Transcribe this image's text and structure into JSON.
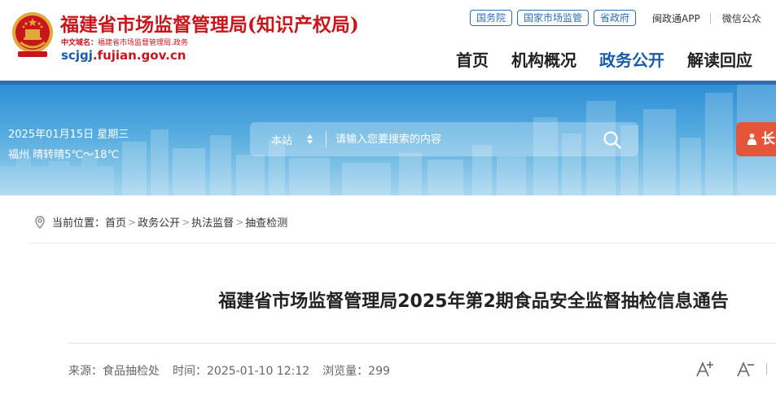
{
  "header": {
    "title": "福建省市场监督管理局(知识产权局)",
    "domain_cn_label": "中文域名：",
    "domain_cn": "福建省市场监督管理局.政务",
    "domain_prefix": "scjgj",
    "domain_suffix": ".fujian.gov.cn",
    "emblem_icon": "national-emblem-icon",
    "top_links": [
      "国务院",
      "国家市场监管",
      "省政府"
    ],
    "app_link": "闽政通APP",
    "wechat_link": "微信公众"
  },
  "nav": {
    "items": [
      "首页",
      "机构概况",
      "政务公开",
      "解读回应"
    ],
    "active": "政务公开"
  },
  "banner": {
    "date": "2025年01月15日 星期三",
    "weather": "福州 晴转晴5℃～18℃",
    "search_scope": "本站",
    "search_placeholder": "请输入您要搜索的内容",
    "elder_label": "长"
  },
  "breadcrumb": {
    "prefix": "当前位置：",
    "items": [
      "首页",
      "政务公开",
      "执法监督",
      "抽查检测"
    ]
  },
  "article": {
    "title": "福建省市场监督管理局2025年第2期食品安全监督抽检信息通告",
    "source": "来源：食品抽检处",
    "time": "时间：2025-01-10 12:12",
    "views": "浏览量：299"
  },
  "colors": {
    "brand_red": "#c8161d",
    "brand_blue": "#1a5ca8",
    "banner_blue": "#2e8fd6",
    "elder_orange": "#e5553a"
  }
}
